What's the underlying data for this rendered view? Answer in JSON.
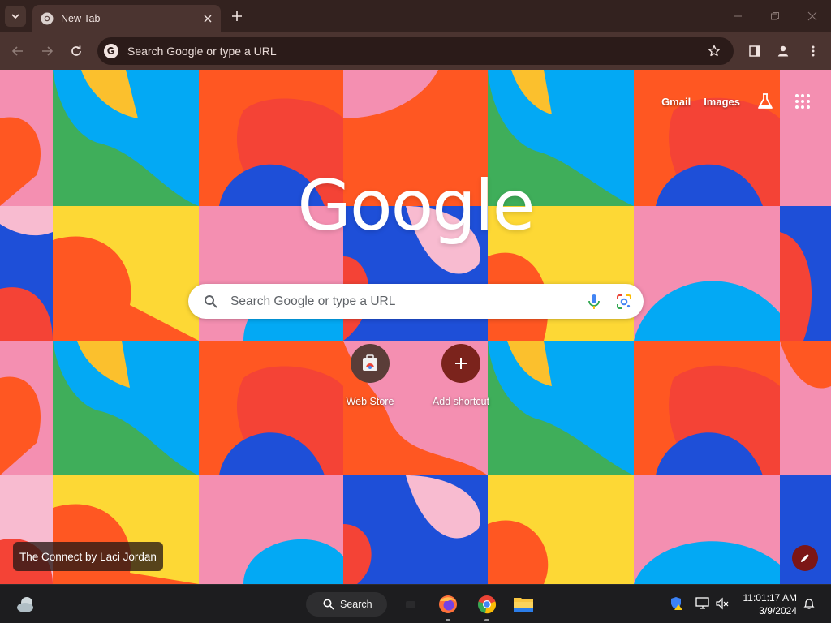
{
  "browser": {
    "tab": {
      "title": "New Tab",
      "favicon": "chrome-icon"
    },
    "omnibox": {
      "placeholder": "Search Google or type a URL",
      "icon": "google-g-icon"
    },
    "colors": {
      "frame": "#33221f",
      "toolbar": "#4b3430",
      "omnibox": "#2b1b19"
    }
  },
  "ntp": {
    "top_links": {
      "gmail": "Gmail",
      "images": "Images"
    },
    "logo": "Google",
    "search": {
      "placeholder": "Search Google or type a URL"
    },
    "shortcuts": [
      {
        "label": "Web Store",
        "icon": "web-store-icon"
      },
      {
        "label": "Add shortcut",
        "icon": "plus-icon"
      }
    ],
    "background_credit": "The Connect by Laci Jordan",
    "colors": {
      "accent": "#7c1616",
      "shortcut_circle": "#5a3d38"
    }
  },
  "taskbar": {
    "search_label": "Search",
    "clock": {
      "time": "11:01:17 AM",
      "date": "3/9/2024"
    },
    "apps": [
      "firefox-icon",
      "chrome-icon",
      "file-explorer-icon"
    ]
  }
}
